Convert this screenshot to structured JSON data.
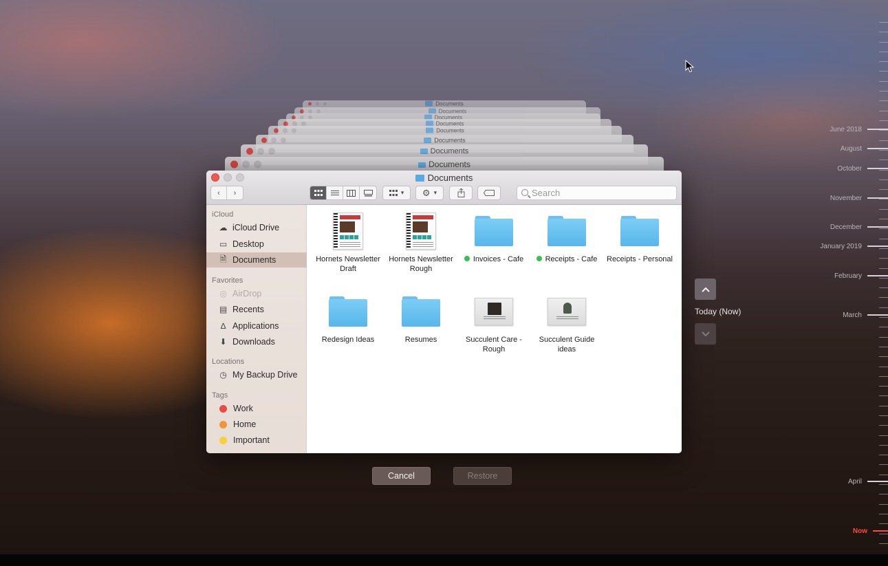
{
  "window": {
    "title": "Documents"
  },
  "history_stack_title": "Documents",
  "toolbar": {
    "search_placeholder": "Search",
    "view_modes": [
      "icon-view",
      "list-view",
      "column-view",
      "gallery-view"
    ],
    "active_view": "icon-view"
  },
  "sidebar": {
    "sections": [
      {
        "heading": "iCloud",
        "items": [
          {
            "label": "iCloud Drive",
            "icon": "cloud-icon"
          },
          {
            "label": "Desktop",
            "icon": "desktop-icon"
          },
          {
            "label": "Documents",
            "icon": "documents-icon",
            "selected": true
          }
        ]
      },
      {
        "heading": "Favorites",
        "items": [
          {
            "label": "AirDrop",
            "icon": "airdrop-icon",
            "disabled": true
          },
          {
            "label": "Recents",
            "icon": "recents-icon"
          },
          {
            "label": "Applications",
            "icon": "applications-icon"
          },
          {
            "label": "Downloads",
            "icon": "downloads-icon"
          }
        ]
      },
      {
        "heading": "Locations",
        "items": [
          {
            "label": "My Backup Drive",
            "icon": "drive-icon"
          }
        ]
      },
      {
        "heading": "Tags",
        "items": [
          {
            "label": "Work",
            "color": "#e94b43"
          },
          {
            "label": "Home",
            "color": "#f0953a"
          },
          {
            "label": "Important",
            "color": "#f3d23c"
          }
        ]
      }
    ]
  },
  "files": [
    {
      "name": "Hornets Newsletter Draft",
      "kind": "document"
    },
    {
      "name": "Hornets Newsletter Rough",
      "kind": "document"
    },
    {
      "name": "Invoices - Cafe",
      "kind": "folder",
      "tag": "#38c152"
    },
    {
      "name": "Receipts - Cafe",
      "kind": "folder",
      "tag": "#38c152"
    },
    {
      "name": "Receipts - Personal",
      "kind": "folder"
    },
    {
      "name": "Redesign Ideas",
      "kind": "folder"
    },
    {
      "name": "Resumes",
      "kind": "folder"
    },
    {
      "name": "Succulent Care - Rough",
      "kind": "image"
    },
    {
      "name": "Succulent Guide ideas",
      "kind": "image"
    }
  ],
  "buttons": {
    "cancel": "Cancel",
    "restore": "Restore"
  },
  "navigation": {
    "current": "Today (Now)"
  },
  "timeline": {
    "labels": [
      "June 2018",
      "August",
      "October",
      "November",
      "December",
      "January 2019",
      "February",
      "March",
      "April"
    ],
    "now_label": "Now"
  }
}
